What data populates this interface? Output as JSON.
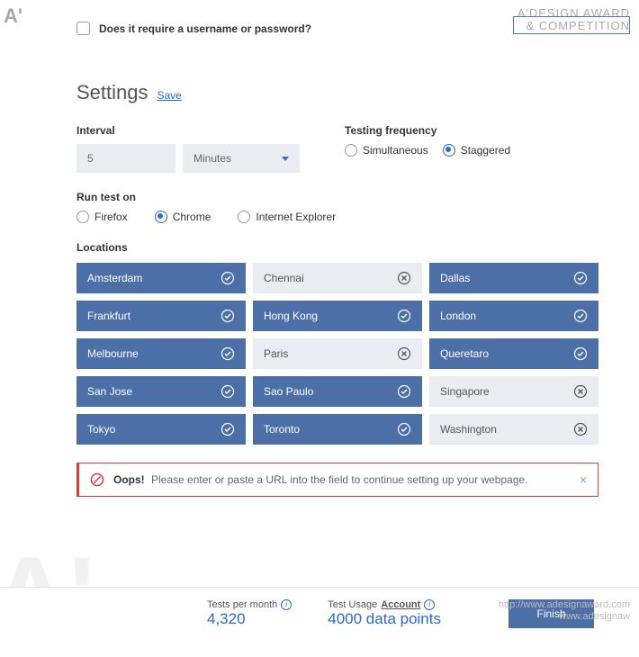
{
  "header": {
    "checkbox_label": "Does it require a username or password?",
    "brand_line1": "A'DESIGN AWARD",
    "brand_line2": "& COMPETITION"
  },
  "settings": {
    "title": "Settings",
    "save_label": "Save",
    "interval": {
      "label": "Interval",
      "value": "5",
      "unit": "Minutes"
    },
    "frequency": {
      "label": "Testing frequency",
      "options": {
        "simultaneous": "Simultaneous",
        "staggered": "Staggered"
      },
      "selected": "staggered"
    },
    "browser": {
      "label": "Run test on",
      "options": {
        "firefox": "Firefox",
        "chrome": "Chrome",
        "ie": "Internet Explorer"
      },
      "selected": "chrome"
    },
    "locations_label": "Locations",
    "locations": [
      {
        "name": "Amsterdam",
        "selected": true
      },
      {
        "name": "Chennai",
        "selected": false
      },
      {
        "name": "Dallas",
        "selected": true
      },
      {
        "name": "Frankfurt",
        "selected": true
      },
      {
        "name": "Hong Kong",
        "selected": true
      },
      {
        "name": "London",
        "selected": true
      },
      {
        "name": "Melbourne",
        "selected": true
      },
      {
        "name": "Paris",
        "selected": false
      },
      {
        "name": "Queretaro",
        "selected": true
      },
      {
        "name": "San Jose",
        "selected": true
      },
      {
        "name": "Sao Paulo",
        "selected": true
      },
      {
        "name": "Singapore",
        "selected": false
      },
      {
        "name": "Tokyo",
        "selected": true
      },
      {
        "name": "Toronto",
        "selected": true
      },
      {
        "name": "Washington",
        "selected": false
      }
    ]
  },
  "error": {
    "title": "Oops!",
    "message": "Please enter or paste a URL into the field to continue setting up your webpage."
  },
  "footer": {
    "tests_label": "Tests per month",
    "tests_value": "4,320",
    "usage_label_prefix": "Test Usage",
    "usage_label_link": "Account",
    "usage_value": "4000 data points",
    "finish_label": "Finish",
    "watermark1": "http://www.adesignaward.com",
    "watermark2": "www.adesignaw"
  }
}
